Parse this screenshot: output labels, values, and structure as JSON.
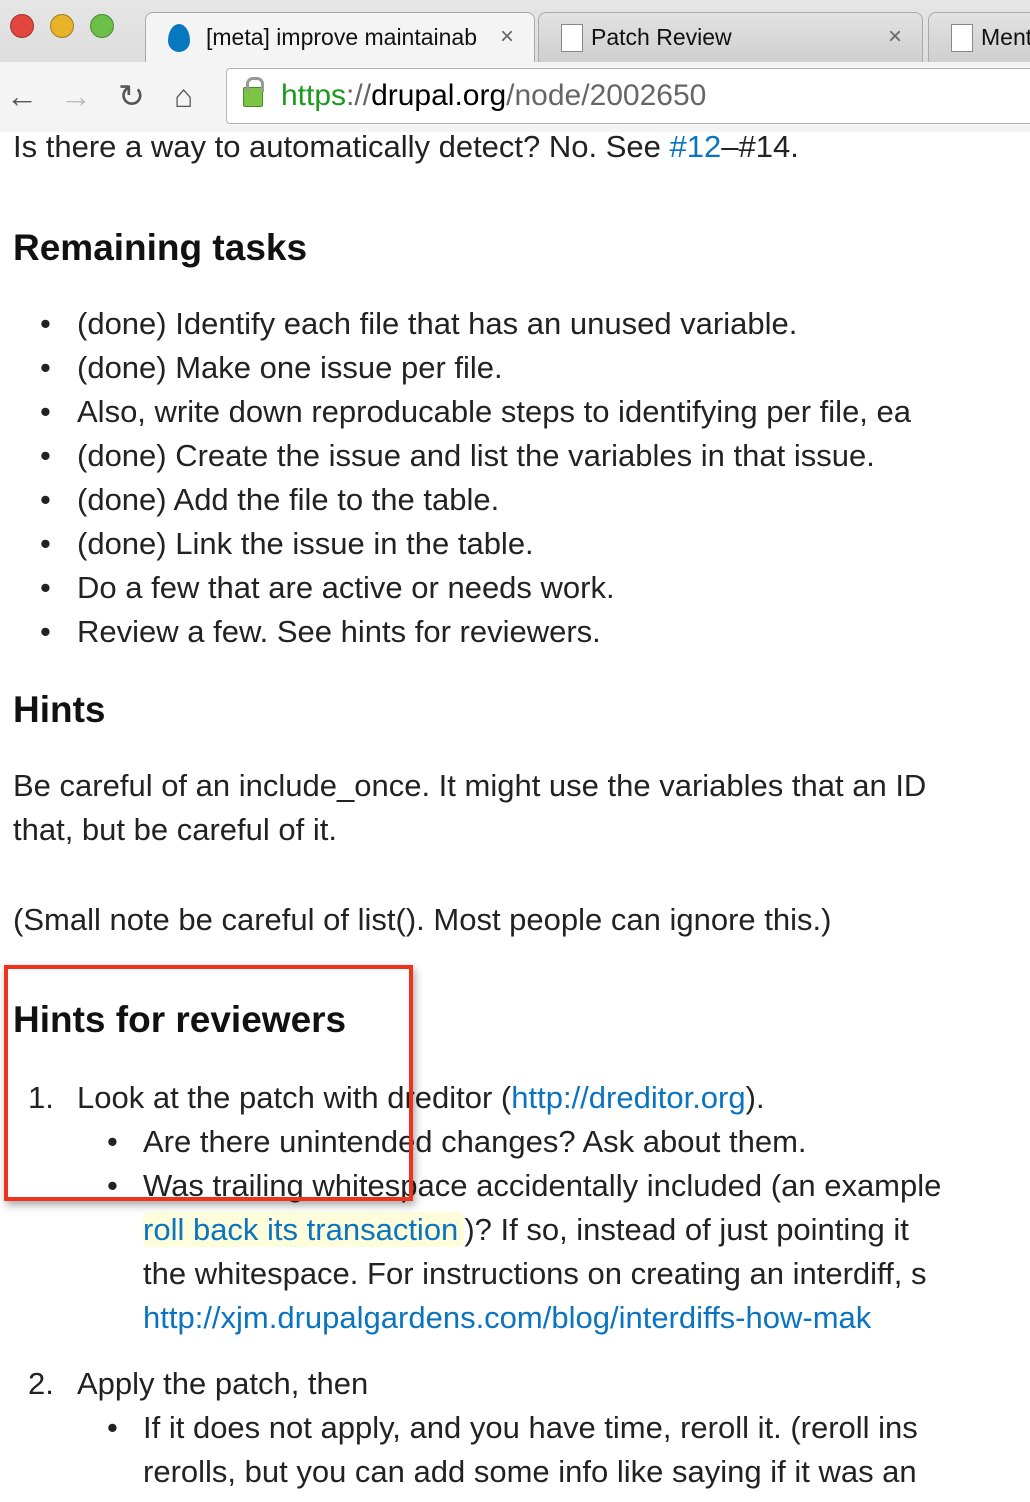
{
  "browser": {
    "tabs": [
      {
        "label": "[meta] improve maintainab",
        "close": "×",
        "icon": "drupal-icon"
      },
      {
        "label": "Patch Review",
        "close": "×",
        "icon": "page-icon"
      },
      {
        "label": "Ment",
        "icon": "page-icon"
      }
    ],
    "url": {
      "scheme": "https",
      "sep": "://",
      "host": "drupal.org",
      "path": "/node/2002650"
    },
    "nav": {
      "back": "←",
      "forward": "→",
      "reload": "↻",
      "home": "⌂"
    }
  },
  "content": {
    "intro": {
      "pre": "Is there a way to automatically detect? No. See ",
      "link": "#12",
      "post": "–#14."
    },
    "remaining_title": "Remaining tasks",
    "remaining": [
      "(done) Identify each file that has an unused variable.",
      "(done) Make one issue per file.",
      "Also, write down reproducable steps to identifying per file, ea",
      "(done) Create the issue and list the variables in that issue.",
      "(done) Add the file to the table.",
      "(done) Link the issue in the table.",
      "Do a few that are active or needs work.",
      "Review a few. See hints for reviewers."
    ],
    "hints_title": "Hints",
    "hints_p1a": "Be careful of an include_once. It might use the variables that an ID",
    "hints_p1b": "that, but be careful of it.",
    "hints_p2": "(Small note be careful of list(). Most people can ignore this.)",
    "reviewers_title": "Hints for reviewers",
    "r1": {
      "num": "1.",
      "pre": "Look at the patch with dreditor (",
      "link": "http://dreditor.org",
      "post": ")."
    },
    "r1b1": "Are there unintended changes? Ask about them.",
    "r1b2": "Was trailing whitespace accidentally included (an example",
    "r1b2_link": "roll back its transaction",
    "r1b2_post": ")? If so, instead of just pointing it",
    "r1b2_l3": "the whitespace. For instructions on creating an interdiff, s",
    "r1b2_l4": "http://xjm.drupalgardens.com/blog/interdiffs-how-mak",
    "r2": {
      "num": "2.",
      "text": "Apply the patch, then"
    },
    "r2b1a": "If it does not apply, and you have time, reroll it. (reroll ins",
    "r2b1b": "rerolls, but you can add some info like saying if it was an",
    "bullet": "•"
  }
}
